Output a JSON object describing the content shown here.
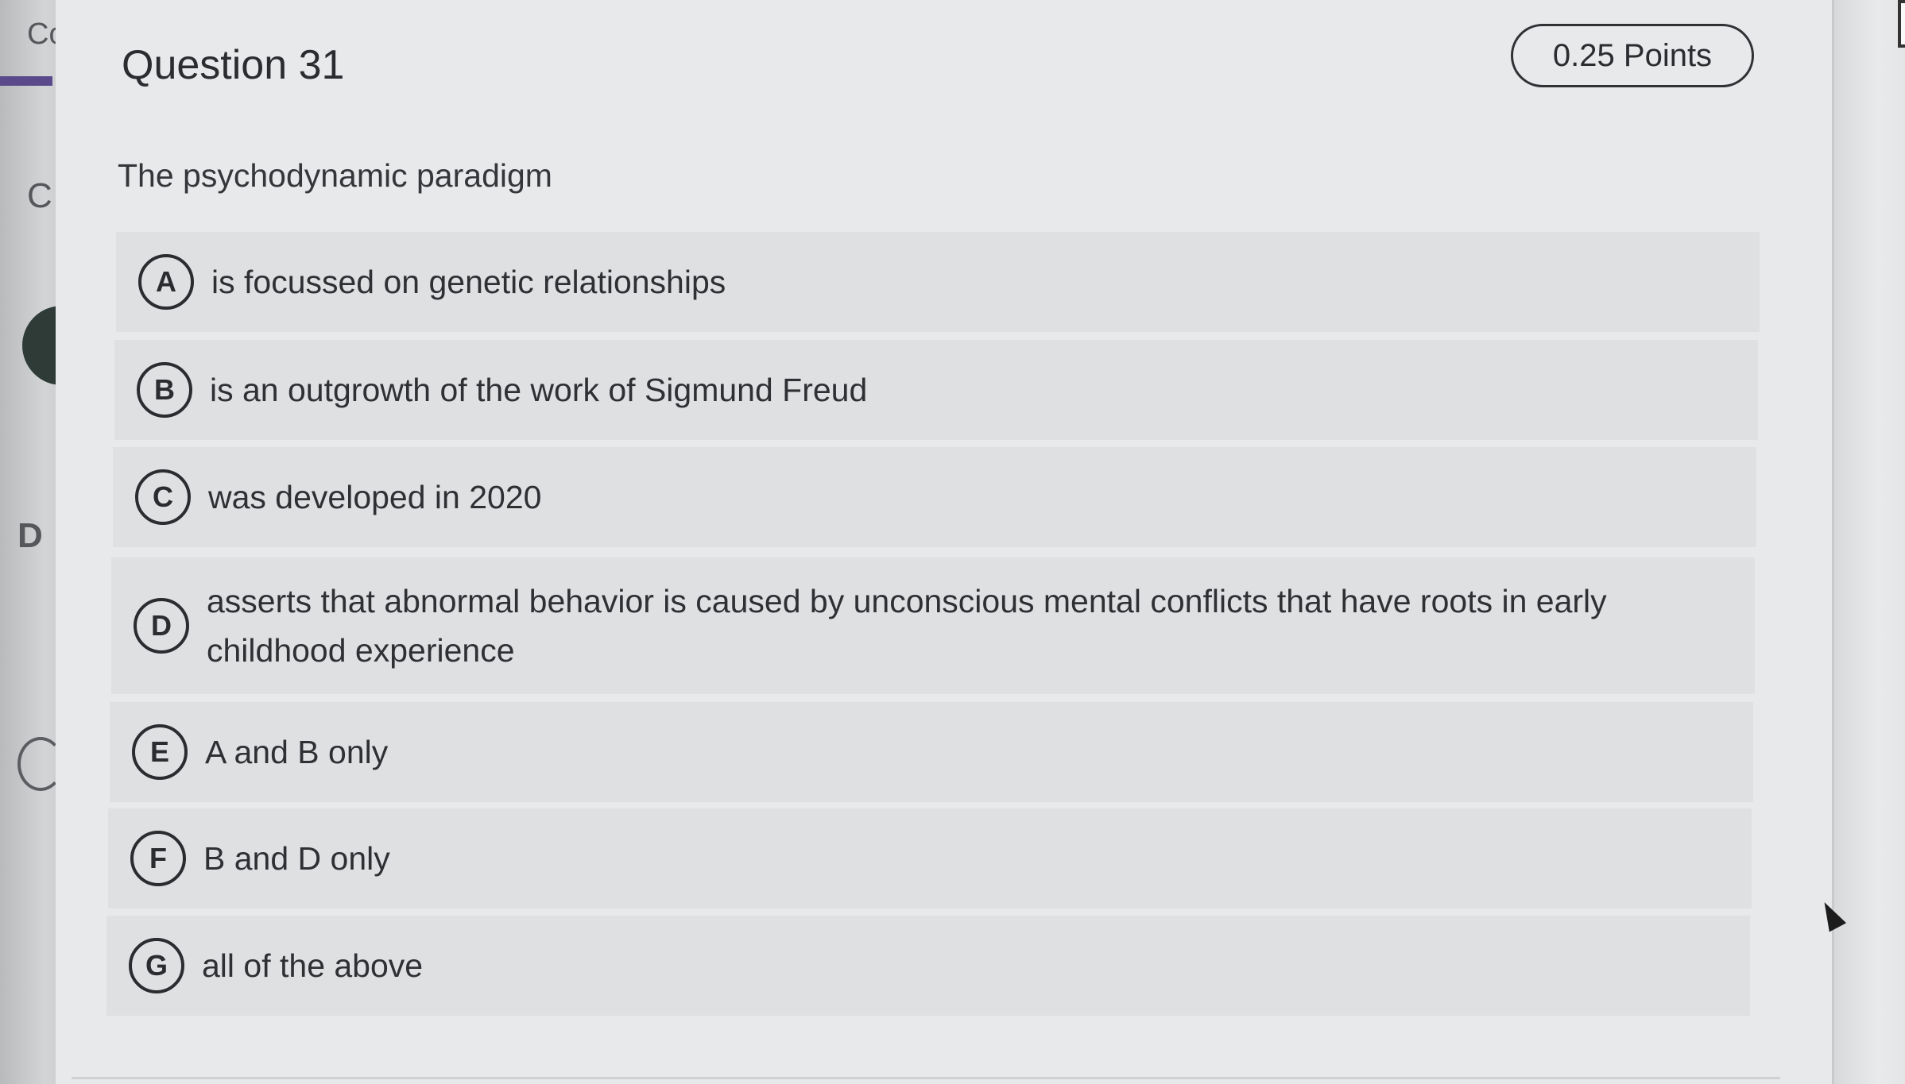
{
  "question": {
    "title": "Question 31",
    "points": "0.25 Points",
    "prompt": "The psychodynamic paradigm"
  },
  "options": [
    {
      "letter": "A",
      "text": "is focussed on genetic relationships"
    },
    {
      "letter": "B",
      "text": "is an outgrowth of the work of Sigmund Freud"
    },
    {
      "letter": "C",
      "text": "was developed in 2020"
    },
    {
      "letter": "D",
      "text": "asserts that abnormal behavior is caused by unconscious mental conflicts that have roots in early childhood experience"
    },
    {
      "letter": "E",
      "text": "A and B only"
    },
    {
      "letter": "F",
      "text": "B and D only"
    },
    {
      "letter": "G",
      "text": "all of the above"
    }
  ],
  "left_fragments": [
    "Co",
    "C",
    "D"
  ]
}
